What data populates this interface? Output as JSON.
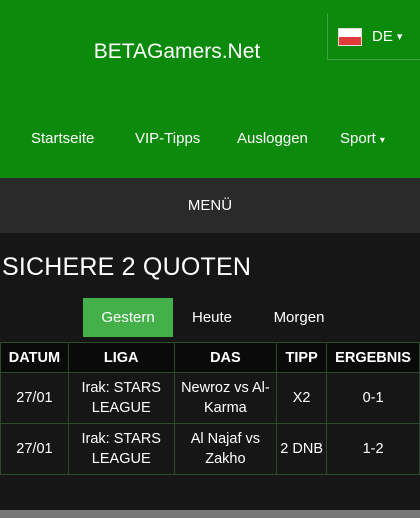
{
  "header": {
    "brand": "BETAGamers.Net",
    "language": {
      "label": "DE",
      "icon": "flag-icon",
      "caret": "▾"
    },
    "nav": [
      {
        "label": "Startseite"
      },
      {
        "label": "VIP-Tipps"
      },
      {
        "label": "Ausloggen"
      },
      {
        "label": "Sport",
        "caret": "▾"
      }
    ]
  },
  "menubar": {
    "label": "MENÜ"
  },
  "main": {
    "title": "SICHERE 2 QUOTEN",
    "tabs": [
      {
        "label": "Gestern",
        "active": true
      },
      {
        "label": "Heute",
        "active": false
      },
      {
        "label": "Morgen",
        "active": false
      }
    ],
    "table": {
      "columns": [
        "DATUM",
        "LIGA",
        "DAS",
        "TIPP",
        "ERGEBNIS"
      ],
      "rows": [
        {
          "datum": "27/01",
          "liga": "Irak: STARS LEAGUE",
          "das": "Newroz vs Al-Karma",
          "tipp": "X2",
          "ergebnis": "0-1"
        },
        {
          "datum": "27/01",
          "liga": "Irak: STARS LEAGUE",
          "das": "Al Najaf vs Zakho",
          "tipp": "2 DNB",
          "ergebnis": "1-2"
        }
      ]
    }
  },
  "colors": {
    "header_bg": "#0b8a0b",
    "tab_active": "#44b04a",
    "menubar_bg": "#2a2a2a",
    "page_bg": "#161616"
  }
}
